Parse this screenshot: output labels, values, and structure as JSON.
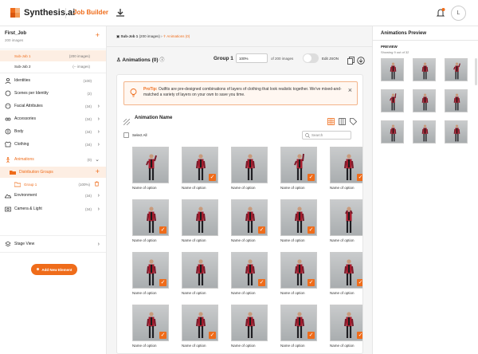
{
  "app": {
    "brand": "Synthesis.ai",
    "section": "Job Builder",
    "avatar_initial": "L",
    "accent": "#ef6c1a"
  },
  "sidebar": {
    "job_name": "First_Job",
    "job_sub": "200 images",
    "subjobs": [
      {
        "label": "Sub-Job 1",
        "count": "(200 images)",
        "selected": true
      },
      {
        "label": "Sub-Job 2",
        "count": "(-- images)",
        "selected": false
      }
    ],
    "items": [
      {
        "label": "Identities",
        "count": "(100)",
        "icon": "identities-icon"
      },
      {
        "label": "Scenes per Identity",
        "count": "(2)",
        "icon": "scenes-icon"
      },
      {
        "label": "Facial Attributes",
        "count": "(34)",
        "icon": "face-icon"
      },
      {
        "label": "Accessories",
        "count": "(34)",
        "icon": "accessories-icon"
      },
      {
        "label": "Body",
        "count": "(34)",
        "icon": "body-icon"
      },
      {
        "label": "Clothing",
        "count": "(34)",
        "icon": "clothing-icon"
      },
      {
        "label": "Animations",
        "count": "(0)",
        "icon": "animations-icon"
      }
    ],
    "distribution_groups": "Distribution Groups",
    "group1": {
      "label": "Group 1",
      "pct": "(100%)"
    },
    "after": [
      {
        "label": "Environment",
        "count": "(34)",
        "icon": "environment-icon"
      },
      {
        "label": "Camera & Light",
        "count": "(34)",
        "icon": "camera-icon"
      }
    ],
    "stage_view": "Stage View",
    "add_new_element": "Add New Element"
  },
  "main": {
    "breadcrumb": {
      "subjob": "Sub-Job 1",
      "subjob_count": "(200 images)",
      "current": "Animations",
      "current_count": "(0)"
    },
    "animations_title": "Animations (0)",
    "group_label": "Group 1",
    "pct_value": "100%",
    "of_images": "of 200 images",
    "edit_json": "Edit JSON",
    "protip_title": "ProTip:",
    "protip_text": "Outfits are pre-designed combinations of layers of clothing that look realistic together. We've mixed-and-matched a variety of layers on your own to save you time.",
    "section_label": "Animation Name",
    "select_all": "Select All",
    "search_placeholder": "Search",
    "cards": [
      {
        "caption": "Name of option",
        "checked": false,
        "pose": "wave"
      },
      {
        "caption": "Name of option",
        "checked": true,
        "pose": "stand"
      },
      {
        "caption": "Name of option",
        "checked": false,
        "pose": "stand"
      },
      {
        "caption": "Name of option",
        "checked": true,
        "pose": "raise"
      },
      {
        "caption": "Name of option",
        "checked": true,
        "pose": "stand"
      },
      {
        "caption": "Name of option",
        "checked": true,
        "pose": "stand"
      },
      {
        "caption": "Name of option",
        "checked": false,
        "pose": "stand"
      },
      {
        "caption": "Name of option",
        "checked": true,
        "pose": "stand"
      },
      {
        "caption": "Name of option",
        "checked": true,
        "pose": "stand"
      },
      {
        "caption": "Name of option",
        "checked": false,
        "pose": "arms"
      },
      {
        "caption": "Name of option",
        "checked": true,
        "pose": "stand"
      },
      {
        "caption": "Name of option",
        "checked": false,
        "pose": "stand"
      },
      {
        "caption": "Name of option",
        "checked": true,
        "pose": "stand"
      },
      {
        "caption": "Name of option",
        "checked": true,
        "pose": "stand"
      },
      {
        "caption": "Name of option",
        "checked": true,
        "pose": "stand"
      },
      {
        "caption": "Name of option",
        "checked": true,
        "pose": "stand"
      },
      {
        "caption": "Name of option",
        "checked": true,
        "pose": "stand"
      },
      {
        "caption": "Name of option",
        "checked": false,
        "pose": "stand"
      },
      {
        "caption": "Name of option",
        "checked": true,
        "pose": "stand"
      },
      {
        "caption": "Name of option",
        "checked": true,
        "pose": "stand"
      }
    ]
  },
  "preview": {
    "title": "Animations Preview",
    "label": "PREVIEW",
    "showing": "Showing 9 out of 32",
    "items": [
      "stand",
      "stand",
      "wave",
      "raise",
      "stand",
      "stand",
      "stand",
      "stand",
      "stand"
    ]
  }
}
